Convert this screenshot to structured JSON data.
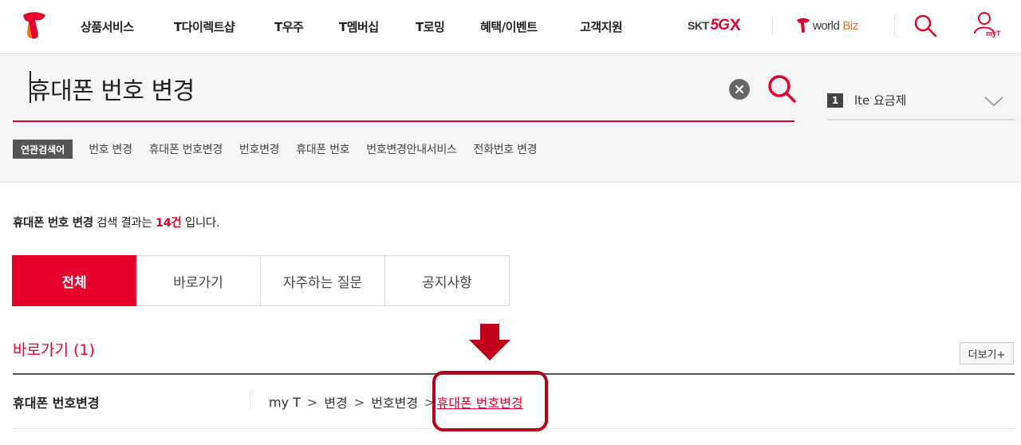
{
  "header": {
    "nav": [
      "상품서비스",
      "T다이렉트샵",
      "T우주",
      "T멤버십",
      "T로밍",
      "혜택/이벤트",
      "고객지원"
    ],
    "brand_skt": "SKT",
    "brand_5g": "5G",
    "brand_x": "X",
    "worldbiz_world": "world",
    "worldbiz_biz": "Biz",
    "myt_label": "myT"
  },
  "search": {
    "query": "휴대폰 번호 변경",
    "suggest_rank": "1",
    "suggest_keyword": "lte 요금제",
    "related_label": "연관검색어",
    "related": [
      "번호 변경",
      "휴대폰 번호변경",
      "번호변경",
      "휴대폰 번호",
      "번호변경안내서비스",
      "전화번호 변경"
    ]
  },
  "summary": {
    "keyword": "휴대폰 번호 변경",
    "mid": " 검색 결과는 ",
    "count": "14건",
    "tail": " 입니다."
  },
  "tabs": [
    {
      "label": "전체",
      "active": true
    },
    {
      "label": "바로가기",
      "active": false
    },
    {
      "label": "자주하는 질문",
      "active": false
    },
    {
      "label": "공지사항",
      "active": false
    }
  ],
  "section": {
    "title": "바로가기 (1)",
    "more": "더보기+",
    "result_title": "휴대폰 번호변경",
    "breadcrumb": [
      "my T",
      "변경",
      "번호변경"
    ],
    "breadcrumb_link": "휴대폰 번호변경",
    "breadcrumb_sep": ">"
  },
  "colors": {
    "accent": "#e6002d",
    "highlight": "#b40019"
  }
}
